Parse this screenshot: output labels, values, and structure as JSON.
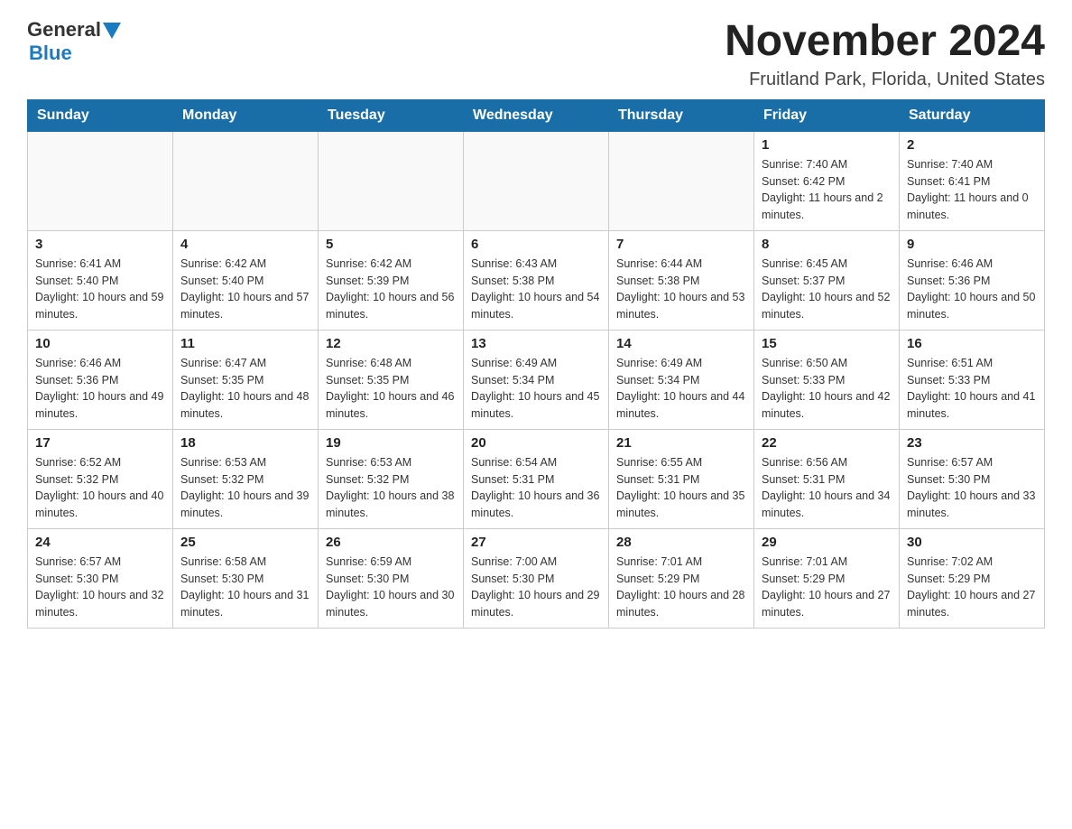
{
  "header": {
    "logo_general": "General",
    "logo_blue": "Blue",
    "title": "November 2024",
    "location": "Fruitland Park, Florida, United States"
  },
  "weekdays": [
    "Sunday",
    "Monday",
    "Tuesday",
    "Wednesday",
    "Thursday",
    "Friday",
    "Saturday"
  ],
  "weeks": [
    [
      {
        "day": "",
        "info": ""
      },
      {
        "day": "",
        "info": ""
      },
      {
        "day": "",
        "info": ""
      },
      {
        "day": "",
        "info": ""
      },
      {
        "day": "",
        "info": ""
      },
      {
        "day": "1",
        "info": "Sunrise: 7:40 AM\nSunset: 6:42 PM\nDaylight: 11 hours and 2 minutes."
      },
      {
        "day": "2",
        "info": "Sunrise: 7:40 AM\nSunset: 6:41 PM\nDaylight: 11 hours and 0 minutes."
      }
    ],
    [
      {
        "day": "3",
        "info": "Sunrise: 6:41 AM\nSunset: 5:40 PM\nDaylight: 10 hours and 59 minutes."
      },
      {
        "day": "4",
        "info": "Sunrise: 6:42 AM\nSunset: 5:40 PM\nDaylight: 10 hours and 57 minutes."
      },
      {
        "day": "5",
        "info": "Sunrise: 6:42 AM\nSunset: 5:39 PM\nDaylight: 10 hours and 56 minutes."
      },
      {
        "day": "6",
        "info": "Sunrise: 6:43 AM\nSunset: 5:38 PM\nDaylight: 10 hours and 54 minutes."
      },
      {
        "day": "7",
        "info": "Sunrise: 6:44 AM\nSunset: 5:38 PM\nDaylight: 10 hours and 53 minutes."
      },
      {
        "day": "8",
        "info": "Sunrise: 6:45 AM\nSunset: 5:37 PM\nDaylight: 10 hours and 52 minutes."
      },
      {
        "day": "9",
        "info": "Sunrise: 6:46 AM\nSunset: 5:36 PM\nDaylight: 10 hours and 50 minutes."
      }
    ],
    [
      {
        "day": "10",
        "info": "Sunrise: 6:46 AM\nSunset: 5:36 PM\nDaylight: 10 hours and 49 minutes."
      },
      {
        "day": "11",
        "info": "Sunrise: 6:47 AM\nSunset: 5:35 PM\nDaylight: 10 hours and 48 minutes."
      },
      {
        "day": "12",
        "info": "Sunrise: 6:48 AM\nSunset: 5:35 PM\nDaylight: 10 hours and 46 minutes."
      },
      {
        "day": "13",
        "info": "Sunrise: 6:49 AM\nSunset: 5:34 PM\nDaylight: 10 hours and 45 minutes."
      },
      {
        "day": "14",
        "info": "Sunrise: 6:49 AM\nSunset: 5:34 PM\nDaylight: 10 hours and 44 minutes."
      },
      {
        "day": "15",
        "info": "Sunrise: 6:50 AM\nSunset: 5:33 PM\nDaylight: 10 hours and 42 minutes."
      },
      {
        "day": "16",
        "info": "Sunrise: 6:51 AM\nSunset: 5:33 PM\nDaylight: 10 hours and 41 minutes."
      }
    ],
    [
      {
        "day": "17",
        "info": "Sunrise: 6:52 AM\nSunset: 5:32 PM\nDaylight: 10 hours and 40 minutes."
      },
      {
        "day": "18",
        "info": "Sunrise: 6:53 AM\nSunset: 5:32 PM\nDaylight: 10 hours and 39 minutes."
      },
      {
        "day": "19",
        "info": "Sunrise: 6:53 AM\nSunset: 5:32 PM\nDaylight: 10 hours and 38 minutes."
      },
      {
        "day": "20",
        "info": "Sunrise: 6:54 AM\nSunset: 5:31 PM\nDaylight: 10 hours and 36 minutes."
      },
      {
        "day": "21",
        "info": "Sunrise: 6:55 AM\nSunset: 5:31 PM\nDaylight: 10 hours and 35 minutes."
      },
      {
        "day": "22",
        "info": "Sunrise: 6:56 AM\nSunset: 5:31 PM\nDaylight: 10 hours and 34 minutes."
      },
      {
        "day": "23",
        "info": "Sunrise: 6:57 AM\nSunset: 5:30 PM\nDaylight: 10 hours and 33 minutes."
      }
    ],
    [
      {
        "day": "24",
        "info": "Sunrise: 6:57 AM\nSunset: 5:30 PM\nDaylight: 10 hours and 32 minutes."
      },
      {
        "day": "25",
        "info": "Sunrise: 6:58 AM\nSunset: 5:30 PM\nDaylight: 10 hours and 31 minutes."
      },
      {
        "day": "26",
        "info": "Sunrise: 6:59 AM\nSunset: 5:30 PM\nDaylight: 10 hours and 30 minutes."
      },
      {
        "day": "27",
        "info": "Sunrise: 7:00 AM\nSunset: 5:30 PM\nDaylight: 10 hours and 29 minutes."
      },
      {
        "day": "28",
        "info": "Sunrise: 7:01 AM\nSunset: 5:29 PM\nDaylight: 10 hours and 28 minutes."
      },
      {
        "day": "29",
        "info": "Sunrise: 7:01 AM\nSunset: 5:29 PM\nDaylight: 10 hours and 27 minutes."
      },
      {
        "day": "30",
        "info": "Sunrise: 7:02 AM\nSunset: 5:29 PM\nDaylight: 10 hours and 27 minutes."
      }
    ]
  ]
}
